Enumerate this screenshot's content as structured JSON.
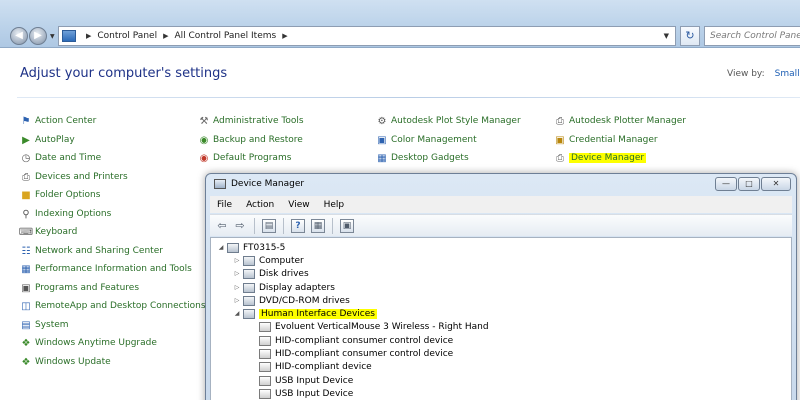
{
  "address": {
    "crumbs": [
      "Control Panel",
      "All Control Panel Items"
    ],
    "search_placeholder": "Search Control Panel"
  },
  "control_panel": {
    "heading": "Adjust your computer's settings",
    "view_by_label": "View by:",
    "view_by_value": "Small icons",
    "columns": [
      [
        "Action Center",
        "AutoPlay",
        "Date and Time",
        "Devices and Printers",
        "Folder Options",
        "Indexing Options",
        "Keyboard",
        "Network and Sharing Center",
        "Performance Information and Tools",
        "Programs and Features",
        "RemoteApp and Desktop Connections",
        "System",
        "Windows Anytime Upgrade",
        "Windows Update"
      ],
      [
        "Administrative Tools",
        "Backup and Restore",
        "Default Programs"
      ],
      [
        "Autodesk Plot Style Manager",
        "Color Management",
        "Desktop Gadgets"
      ],
      [
        "Autodesk Plotter Manager",
        "Credential Manager",
        "Device Manager"
      ]
    ],
    "highlighted_item": "Device Manager",
    "highlight_color": "#fdff00",
    "link_color": "#2a6e28"
  },
  "device_manager": {
    "title": "Device Manager",
    "menu": [
      "File",
      "Action",
      "View",
      "Help"
    ],
    "toolbar_icons": [
      "back-arrow-icon",
      "forward-arrow-icon",
      "show-hide-console-tree-icon",
      "help-icon",
      "properties-icon",
      "scan-hardware-icon"
    ],
    "tree": {
      "root": "FT0315-5",
      "categories": [
        "Computer",
        "Disk drives",
        "Display adapters",
        "DVD/CD-ROM drives",
        "Human Interface Devices"
      ],
      "expanded": "Human Interface Devices",
      "children": [
        "Evoluent VerticalMouse 3 Wireless - Right Hand",
        "HID-compliant consumer control device",
        "HID-compliant consumer control device",
        "HID-compliant device",
        "USB Input Device",
        "USB Input Device"
      ]
    }
  }
}
